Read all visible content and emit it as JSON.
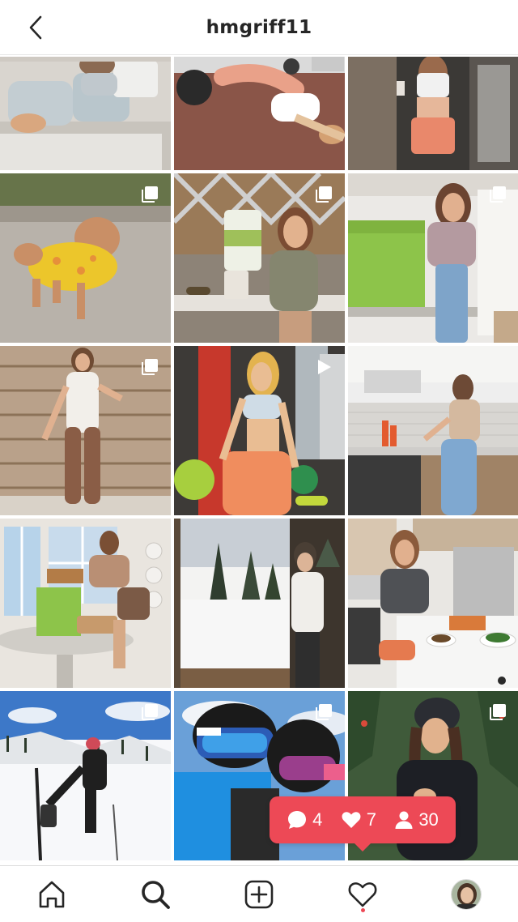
{
  "header": {
    "username": "hmgriff11",
    "back_icon": "chevron-left-icon"
  },
  "grid": {
    "posts": [
      {
        "id": "post-1",
        "badge": "none",
        "scene": "woman-on-bed"
      },
      {
        "id": "post-2",
        "badge": "none",
        "scene": "floor-workout"
      },
      {
        "id": "post-3",
        "badge": "none",
        "scene": "doorway-drink"
      },
      {
        "id": "post-4",
        "badge": "carousel",
        "scene": "dog-yellow-coat"
      },
      {
        "id": "post-5",
        "badge": "carousel",
        "scene": "supplement-table"
      },
      {
        "id": "post-6",
        "badge": "carousel",
        "scene": "hellofresh-box-kitchen"
      },
      {
        "id": "post-7",
        "badge": "carousel",
        "scene": "wood-wall-outfit"
      },
      {
        "id": "post-8",
        "badge": "video",
        "scene": "gym-workout"
      },
      {
        "id": "post-9",
        "badge": "none",
        "scene": "kitchen-cooking"
      },
      {
        "id": "post-10",
        "badge": "none",
        "scene": "hellofresh-dining"
      },
      {
        "id": "post-11",
        "badge": "none",
        "scene": "snowy-window"
      },
      {
        "id": "post-12",
        "badge": "none",
        "scene": "kitchen-counter-meal"
      },
      {
        "id": "post-13",
        "badge": "carousel",
        "scene": "skiing"
      },
      {
        "id": "post-14",
        "badge": "carousel",
        "scene": "ski-goggles"
      },
      {
        "id": "post-15",
        "badge": "carousel",
        "scene": "winter-coat"
      }
    ]
  },
  "activity": {
    "comments": "4",
    "likes": "7",
    "follows": "30",
    "color": "#ed4956"
  },
  "nav": {
    "items": [
      "home-icon",
      "search-icon",
      "new-post-icon",
      "activity-heart-icon",
      "profile-avatar"
    ],
    "active_dot_color": "#ed4956"
  }
}
